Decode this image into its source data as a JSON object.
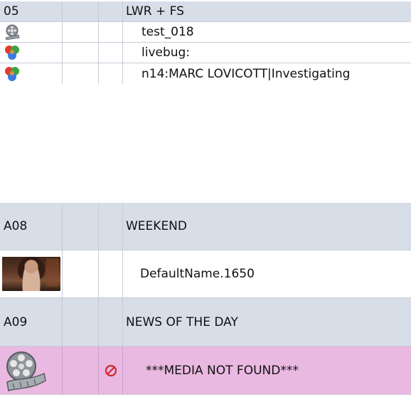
{
  "top_rows": [
    {
      "col0": "05",
      "text": "LWR + FS",
      "kind": "header"
    },
    {
      "icon": "media-reel-icon-gray",
      "text": "test_018",
      "kind": "item"
    },
    {
      "icon": "color-balls-icon",
      "text": "livebug:",
      "kind": "item"
    },
    {
      "icon": "color-balls-icon",
      "text": "n14:MARC LOVICOTT|Investigating",
      "kind": "item"
    }
  ],
  "bottom_rows": [
    {
      "col0": "A08",
      "text": "WEEKEND",
      "kind": "header"
    },
    {
      "icon": "video-thumbnail",
      "text": "DefaultName.1650",
      "kind": "item"
    },
    {
      "col0": "A09",
      "text": "NEWS OF THE DAY",
      "kind": "header"
    },
    {
      "icon": "film-reel-icon",
      "status_icon": "no-entry-icon",
      "text": "***MEDIA NOT FOUND***",
      "kind": "missing"
    }
  ],
  "colors": {
    "header_bg": "#d8dee8",
    "missing_bg": "#e9b9e1",
    "grid_line": "#c6ccd6",
    "no_entry_red": "#d2262b"
  }
}
